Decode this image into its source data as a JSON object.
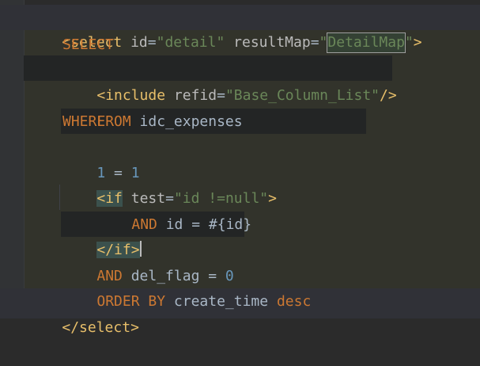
{
  "editor": {
    "lines": {
      "l1": {
        "open": "<",
        "tag": "select",
        "sp1": " ",
        "attr1": "id",
        "eq1": "=",
        "val1": "\"detail\"",
        "sp2": " ",
        "attr2": "resultMap",
        "eq2": "=",
        "q_open": "\"",
        "val2": "DetailMap",
        "q_close": "\"",
        "close": ">"
      },
      "l2": {
        "kw": "SELECT"
      },
      "l3": {
        "open": "<",
        "tag": "include",
        "sp": " ",
        "attr": "refid",
        "eq": "=",
        "val": "\"Base_Column_List\"",
        "close": "/>"
      },
      "l4": {
        "kw": "FROM",
        "rest": " idc_expenses"
      },
      "l5": {
        "kw": "WHERE"
      },
      "l6": {
        "n1": "1",
        "op": " = ",
        "n2": "1"
      },
      "l7": {
        "open": "<",
        "tag": "if",
        "sp": " ",
        "attr": "test",
        "eq": "=",
        "val": "\"id !=null\"",
        "close": ">"
      },
      "l8": {
        "kw": "AND",
        "rest": " id = #{id}"
      },
      "l9": {
        "open": "</",
        "tag": "if",
        "close": ">"
      },
      "l10": {
        "kw": "AND",
        "rest": " del_flag = ",
        "num": "0"
      },
      "l11": {
        "kw1": "ORDER BY",
        "rest": " create_time ",
        "kw2": "desc"
      },
      "l12": {
        "open": "</",
        "tag": "select",
        "close": ">"
      }
    }
  },
  "colors": {
    "background": "#2b2b2b",
    "tag": "#e8bf6a",
    "keyword": "#cc7832",
    "string": "#6a8759",
    "number": "#6897bb",
    "text": "#a9b7c6"
  }
}
